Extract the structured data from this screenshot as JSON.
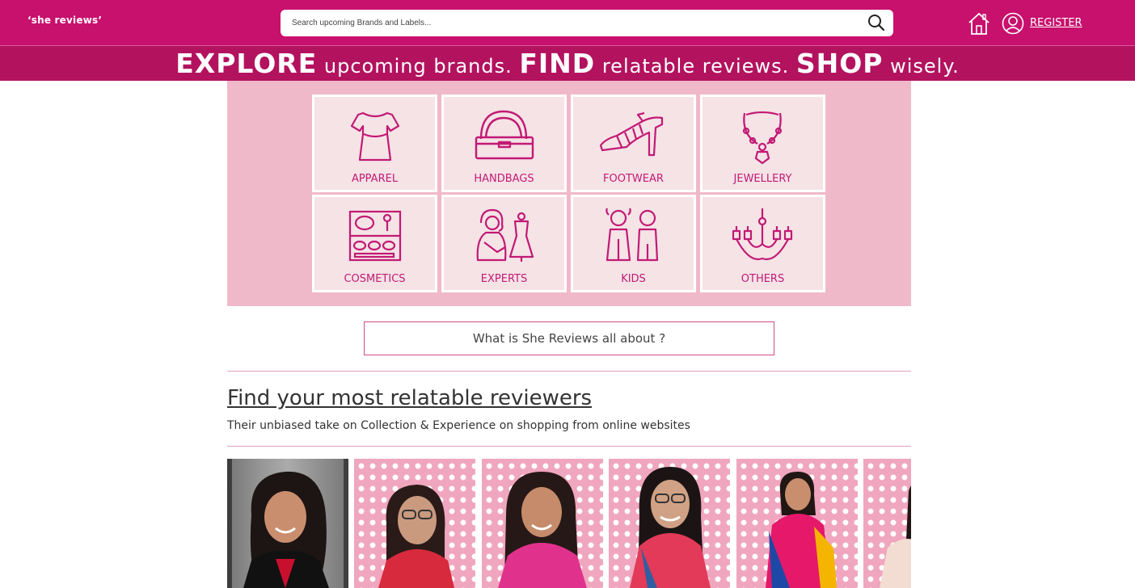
{
  "header": {
    "logo": "‘she reviews’",
    "search_placeholder": "Search upcoming Brands and Labels...",
    "register_label": "REGISTER"
  },
  "banner": {
    "w1": "EXPLORE",
    "t1": " upcoming brands. ",
    "w2": "FIND",
    "t2": " relatable reviews. ",
    "w3": "SHOP",
    "t3": " wisely."
  },
  "categories": [
    {
      "label": "APPAREL",
      "icon": "dress-icon"
    },
    {
      "label": "HANDBAGS",
      "icon": "handbag-icon"
    },
    {
      "label": "FOOTWEAR",
      "icon": "heel-shoe-icon"
    },
    {
      "label": "JEWELLERY",
      "icon": "necklace-icon"
    },
    {
      "label": "COSMETICS",
      "icon": "makeup-palette-icon"
    },
    {
      "label": "EXPERTS",
      "icon": "expert-with-mannequin-icon"
    },
    {
      "label": "KIDS",
      "icon": "kids-icon"
    },
    {
      "label": "OTHERS",
      "icon": "chandelier-icon"
    }
  ],
  "about_button": "What is She Reviews all about ?",
  "reviewers_section": {
    "title": "Find your most relatable reviewers",
    "subtitle": "Their unbiased take on Collection & Experience on shopping from online websites"
  },
  "colors": {
    "brand": "#c8106d",
    "banner": "#b3125f",
    "panel": "#f0b9c9",
    "tile": "#f5e3e6",
    "icon": "#c21a74"
  }
}
